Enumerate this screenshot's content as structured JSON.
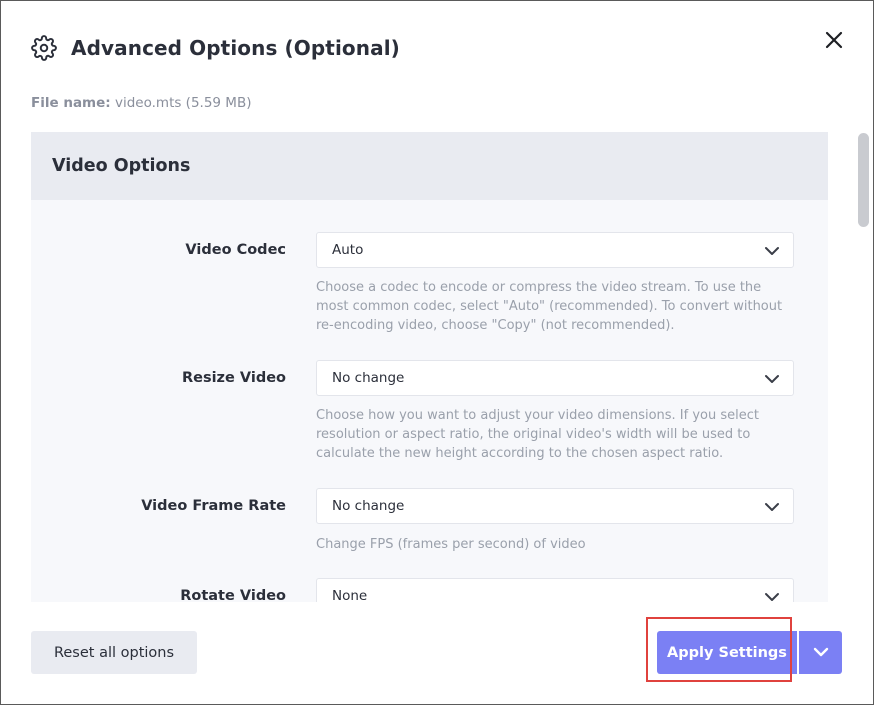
{
  "dialog": {
    "title": "Advanced Options (Optional)",
    "header_icon": "gear-icon",
    "close_icon": "close-icon"
  },
  "file": {
    "label": "File name:",
    "value": "video.mts (5.59 MB)"
  },
  "section": {
    "title": "Video Options"
  },
  "options": [
    {
      "label": "Video Codec",
      "value": "Auto",
      "help": "Choose a codec to encode or compress the video stream. To use the most common codec, select \"Auto\" (recommended). To convert without re-encoding video, choose \"Copy\" (not recommended)."
    },
    {
      "label": "Resize Video",
      "value": "No change",
      "help": "Choose how you want to adjust your video dimensions. If you select resolution or aspect ratio, the original video's width will be used to calculate the new height according to the chosen aspect ratio."
    },
    {
      "label": "Video Frame Rate",
      "value": "No change",
      "help": "Change FPS (frames per second) of video"
    },
    {
      "label": "Rotate Video",
      "value": "None",
      "help": ""
    }
  ],
  "footer": {
    "reset_label": "Reset all options",
    "apply_label": "Apply Settings",
    "dropdown_icon": "chevron-down-icon"
  },
  "colors": {
    "accent": "#7b80f4",
    "highlight": "#e0423e",
    "section_bg": "#e9ebf1"
  }
}
